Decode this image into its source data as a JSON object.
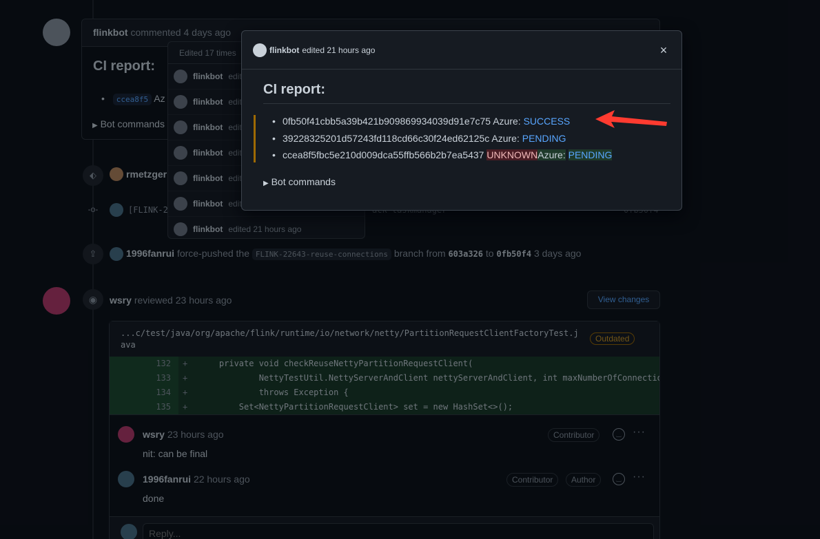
{
  "timeline": {
    "comment1": {
      "author": "flinkbot",
      "action": "commented",
      "time": "4 days ago",
      "title": "CI report:",
      "item_sha": "ccea8f5",
      "item_rest": "Az",
      "details": "Bot commands"
    },
    "history": {
      "header": "Edited 17 times",
      "items": [
        {
          "author": "flinkbot",
          "action": "edit"
        },
        {
          "author": "flinkbot",
          "action": "edit"
        },
        {
          "author": "flinkbot",
          "action": "edit"
        },
        {
          "author": "flinkbot",
          "action": "edit"
        },
        {
          "author": "flinkbot",
          "action": "edit"
        },
        {
          "author": "flinkbot",
          "action": "edit"
        },
        {
          "author": "flinkbot",
          "action": "edited 21 hours ago"
        }
      ]
    },
    "label_event": {
      "author": "rmetzger"
    },
    "commit_event": {
      "text": "[FLINK-2",
      "trail": "ack taskmanager",
      "sha": "0fb50f4"
    },
    "force_push": {
      "author": "1996fanrui",
      "action": "force-pushed the",
      "branch": "FLINK-22643-reuse-connections",
      "from_text": "branch from",
      "from_sha": "603a326",
      "to_text": "to",
      "to_sha": "0fb50f4",
      "time": "3 days ago"
    },
    "review": {
      "author": "wsry",
      "action": "reviewed",
      "time": "23 hours ago",
      "view_changes": "View changes",
      "file_path_1": "...c/test/java/org/apache/flink/runtime/io/network/netty/PartitionRequestClientFactoryTest.j",
      "file_path_2": "ava",
      "outdated": "Outdated",
      "diff": [
        {
          "num": "132",
          "code": "    private void checkReuseNettyPartitionRequestClient("
        },
        {
          "num": "133",
          "code": "            NettyTestUtil.NettyServerAndClient nettyServerAndClient, int maxNumberOfConnections"
        },
        {
          "num": "134",
          "code": "            throws Exception {"
        },
        {
          "num": "135",
          "code": "        Set<NettyPartitionRequestClient> set = new HashSet<>();"
        }
      ],
      "comments": [
        {
          "author": "wsry",
          "time": "23 hours ago",
          "badge1": "Contributor",
          "badge2": "",
          "body": "nit: can be final"
        },
        {
          "author": "1996fanrui",
          "time": "22 hours ago",
          "badge1": "Contributor",
          "badge2": "Author",
          "body": "done"
        }
      ],
      "reply_placeholder": "Reply..."
    }
  },
  "modal": {
    "author": "flinkbot",
    "action": "edited 21 hours ago",
    "close": "×",
    "title": "CI report:",
    "items": [
      {
        "sha": "0fb50f41cbb5a39b421b909869934039d91e7c75",
        "label": "Azure:",
        "status": "SUCCESS"
      },
      {
        "sha": "39228325201d57243fd118cd66c30f24ed62125c",
        "label": "Azure:",
        "status": "PENDING"
      },
      {
        "sha": "ccea8f5fbc5e210d009dca55ffb566b2b7ea5437",
        "removed": "UNKNOWN",
        "label": "Azure:",
        "status": "PENDING"
      }
    ],
    "details": "Bot commands"
  },
  "colors": {
    "background": "#0d1117",
    "link": "#58a6ff",
    "annotation_arrow": "#ff3b30",
    "changed_bar": "#9e6a03"
  }
}
